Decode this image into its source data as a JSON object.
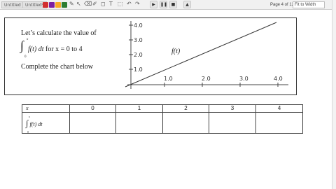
{
  "toolbar": {
    "tabs": [
      "Untitled",
      "Untitled*"
    ],
    "media": [
      "▶",
      "❚❚",
      "■",
      "▲"
    ],
    "page_indicator": "Page 4 of 12",
    "zoom": "Fit to Width",
    "swatch_colors": [
      "#d32f2f",
      "#7b1fa2",
      "#f9a825",
      "#2e7d32"
    ]
  },
  "problem": {
    "intro": "Let’s calculate the value of",
    "integral_sign": "∫",
    "upper": "x",
    "lower": "0",
    "integrand": "f(t) dt",
    "range_text": "for x = 0 to 4",
    "instruction": "Complete the chart below"
  },
  "graph": {
    "x_ticks": [
      "1.0",
      "2.0",
      "3.0",
      "4.0"
    ],
    "y_ticks": [
      "1.0",
      "2.0",
      "3.0",
      "4.0"
    ],
    "function_label": "f(t)",
    "line_color": "#333333"
  },
  "table": {
    "header_label": "x",
    "columns": [
      "0",
      "1",
      "2",
      "3",
      "4"
    ],
    "row_integral_sign": "∫",
    "row_upper": "x",
    "row_lower": "0",
    "row_integrand": "f(t) dt",
    "values": [
      "",
      "",
      "",
      "",
      ""
    ]
  }
}
